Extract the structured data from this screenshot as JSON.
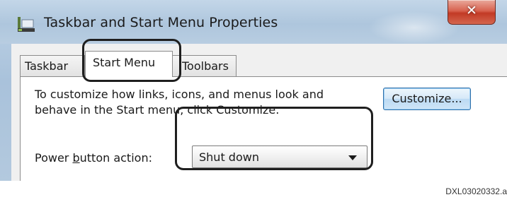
{
  "window": {
    "title": "Taskbar and Start Menu Properties",
    "close_label": "✕",
    "app_icon": "taskbar-window-icon"
  },
  "tabs": [
    {
      "label": "Taskbar",
      "active": false
    },
    {
      "label": "Start Menu",
      "active": true
    },
    {
      "label": "Toolbars",
      "active": false
    }
  ],
  "panel": {
    "description_line1": "To customize how links, icons, and menus look and",
    "description_line2": "behave in the Start menu, click Customize.",
    "customize_label": "Customize...",
    "power_label_prefix": "Power ",
    "power_label_access_key": "b",
    "power_label_suffix": "utton action:",
    "power_select_value": "Shut down"
  },
  "figure_id": "DXL03020332.a",
  "colors": {
    "titlebar": "#aec6dd",
    "close_button": "#c23a25",
    "customize_accent": "#2f6fa8",
    "callout": "#1f1f1f"
  }
}
